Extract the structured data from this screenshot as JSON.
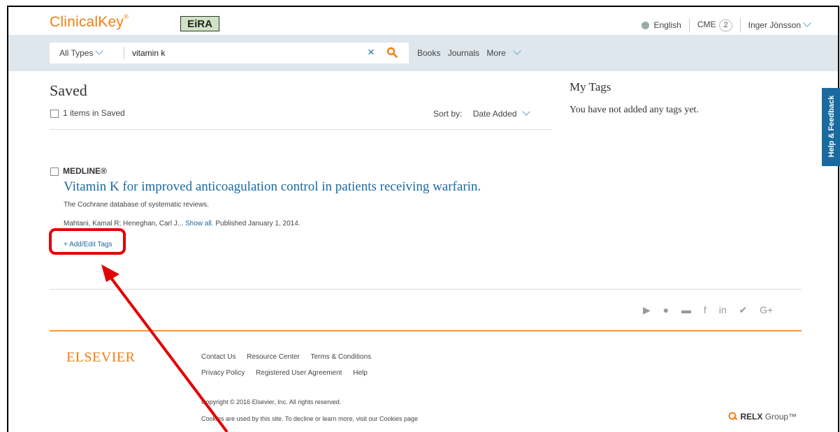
{
  "header": {
    "logo": "ClinicalKey",
    "logo_mark": "®",
    "badge": "EiRA",
    "language": "English",
    "cme_label": "CME",
    "cme_count": "2",
    "user": "Inger Jönsson"
  },
  "search": {
    "type": "All Types",
    "query": "vitamin k",
    "clear": "×",
    "nav": [
      "Books",
      "Journals",
      "More"
    ]
  },
  "saved": {
    "title": "Saved",
    "count": "1 items in Saved",
    "sort_label": "Sort by:",
    "sort_value": "Date Added"
  },
  "result": {
    "source": "MEDLINE®",
    "title": "Vitamin K for improved anticoagulation control in patients receiving warfarin.",
    "journal": "The Cochrane database of systematic reviews.",
    "authors": "Mahtani, Kamal R; Heneghan, Carl J...",
    "show_all": "Show all.",
    "published": "Published January 1, 2014.",
    "tags_link": "+ Add/Edit Tags"
  },
  "sidebar": {
    "title": "My Tags",
    "empty": "You have not added any tags yet."
  },
  "footer": {
    "elsevier": "ELSEVIER",
    "links_row1": [
      "Contact Us",
      "Resource Center",
      "Terms & Conditions"
    ],
    "links_row2": [
      "Privacy Policy",
      "Registered User Agreement",
      "Help"
    ],
    "copyright": "Copyright © 2016 Elsevier, Inc. All rights reserved.",
    "cookies": "Cookies are used by this site. To decline or learn more, visit our Cookies page",
    "relx": "RELX",
    "relx_suffix": "Group™"
  },
  "help_tab": "Help & Feedback",
  "colors": {
    "brand": "#f27e12",
    "link": "#1b6a9f",
    "highlight": "#e30000",
    "search_bar": "#dee7ed"
  },
  "icons": [
    "globe-icon",
    "chevron-down-icon",
    "clear-icon",
    "search-icon",
    "checkbox-icon",
    "video-icon",
    "apple-icon",
    "rss-icon",
    "facebook-icon",
    "linkedin-icon",
    "twitter-icon",
    "google-plus-icon",
    "relx-logo-icon",
    "annotation-arrow-icon"
  ]
}
